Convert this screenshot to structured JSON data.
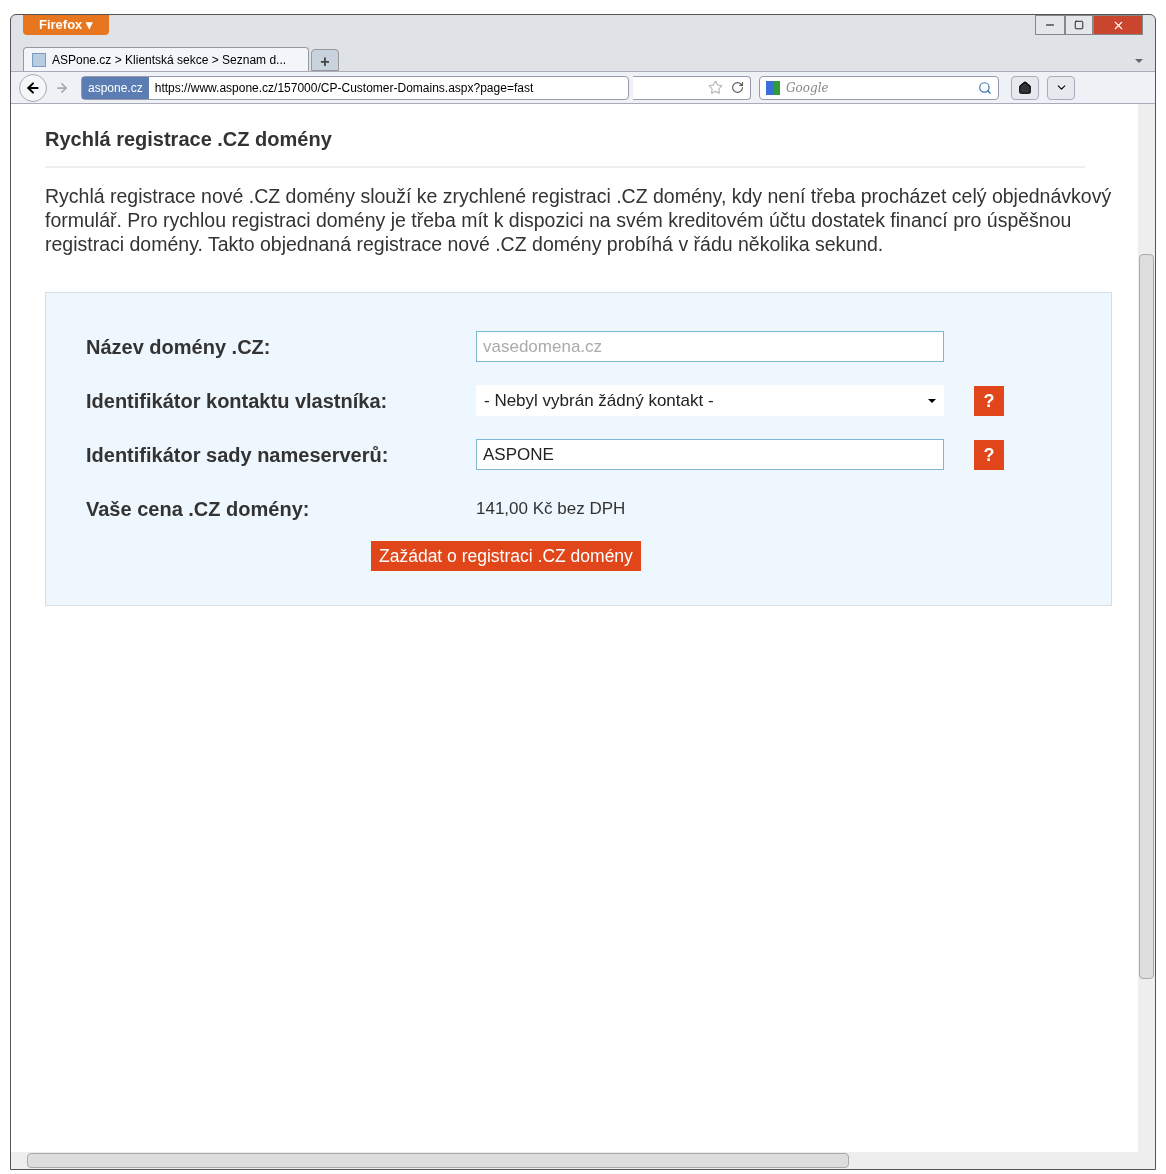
{
  "browser": {
    "menu_button": "Firefox ▾",
    "tab": {
      "title": "ASPone.cz > Klientská sekce > Seznam d...",
      "selected": true
    },
    "new_tab": "+",
    "site_badge": "aspone.cz",
    "url": "https://www.aspone.cz/157000/CP-Customer-Domains.aspx?page=fast",
    "search_placeholder": "Google"
  },
  "page": {
    "heading": "Rychlá registrace .CZ domény",
    "intro": "Rychlá registrace nové .CZ domény slouží ke zrychlené registraci .CZ domény, kdy není třeba procházet celý objednávkový formulář. Pro rychlou registraci domény je třeba mít k dispozici na svém kreditovém účtu dostatek financí pro úspěšnou registraci domény. Takto objednaná registrace nové .CZ domény probíhá v řádu několika sekund.",
    "form": {
      "rows": [
        {
          "kind": "input",
          "label": "Název domény .CZ:",
          "placeholder": "vasedomena.cz"
        },
        {
          "kind": "select",
          "label": "Identifikátor kontaktu vlastníka:",
          "value": "- Nebyl vybrán žádný kontakt -",
          "help": "?"
        },
        {
          "kind": "input",
          "label": "Identifikátor sady nameserverů:",
          "value": "ASPONE",
          "help": "?"
        },
        {
          "kind": "text",
          "label": "Vaše cena .CZ domény:",
          "value": "141,00 Kč bez DPH"
        }
      ],
      "submit": "Zažádat o registraci .CZ domény"
    }
  }
}
